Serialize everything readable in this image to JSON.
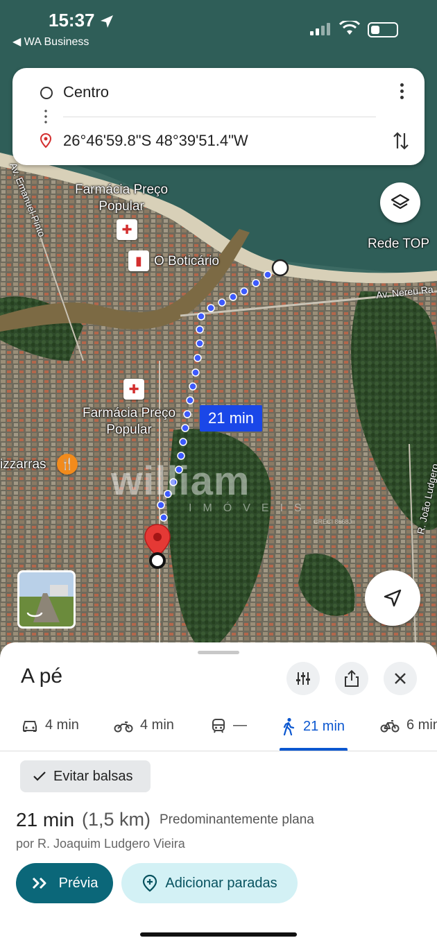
{
  "status_bar": {
    "time": "15:37",
    "back_app": "◀ WA Business"
  },
  "route": {
    "origin": "Centro",
    "destination": "26°46'59.8\"S 48°39'51.4\"W"
  },
  "map": {
    "labels": {
      "pharmacy_1": "Farmácia Preço\nPopular",
      "boticario": "O Boticário",
      "pharmacy_2": "Farmácia Preço\nPopular",
      "pizzarras": "izzarras",
      "rede_top": "Rede TOP",
      "road_emanuel": "Av. Emanuel Pinto",
      "road_nereu": "Av. Nereu Ra",
      "road_joao": "R. João Ludgero"
    },
    "route_time": "21 min",
    "watermark": "william",
    "watermark_sub": "IMÓVEIS",
    "watermark_creci": "CRECI 8668J",
    "route_color": "#3d5afe"
  },
  "sheet": {
    "title": "A pé",
    "modes": [
      {
        "icon": "car-icon",
        "label": "4 min"
      },
      {
        "icon": "motorcycle-icon",
        "label": "4 min"
      },
      {
        "icon": "transit-icon",
        "label": "—"
      },
      {
        "icon": "walk-icon",
        "label": "21 min"
      },
      {
        "icon": "bike-icon",
        "label": "6 min"
      }
    ],
    "chip": "Evitar balsas",
    "duration": "21 min",
    "distance": "(1,5 km)",
    "terrain": "Predominantemente plana",
    "via": "por R. Joaquim Ludgero Vieira",
    "preview_button": "Prévia",
    "add_stops_button": "Adicionar paradas"
  }
}
